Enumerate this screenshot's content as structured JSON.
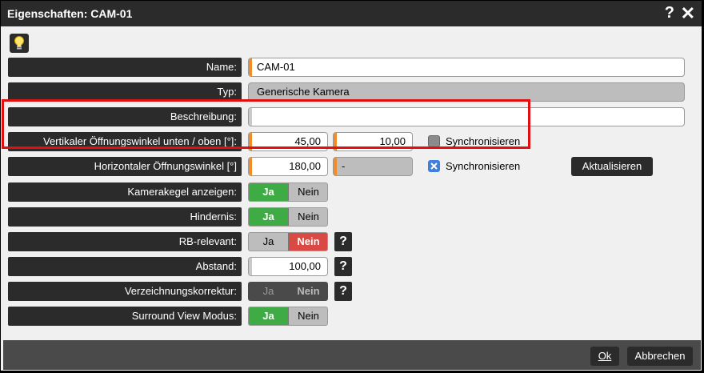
{
  "window": {
    "title": "Eigenschaften: CAM-01",
    "help_glyph": "?",
    "close_glyph": "✕"
  },
  "icons": {
    "hint": "lightbulb-icon",
    "help": "help-icon",
    "close": "close-icon",
    "check": "check-icon"
  },
  "colors": {
    "dark": "#2b2b2b",
    "accent_orange": "#f28c28",
    "toggle_green": "#3fab45",
    "toggle_red": "#d94a44",
    "highlight_red": "#e01010",
    "checkbox_blue": "#3f7fe0"
  },
  "fields": {
    "name": {
      "label": "Name:",
      "value": "CAM-01"
    },
    "typ": {
      "label": "Typ:",
      "value": "Generische Kamera"
    },
    "beschreibung": {
      "label": "Beschreibung:",
      "value": ""
    },
    "vertikal": {
      "label": "Vertikaler Öffnungswinkel unten / oben [°]:",
      "value1": "45,00",
      "value2": "10,00",
      "sync_label": "Synchronisieren",
      "sync_checked": false
    },
    "horizontal": {
      "label": "Horizontaler Öffnungswinkel [°]",
      "value1": "180,00",
      "value2": "-",
      "sync_label": "Synchronisieren",
      "sync_checked": true
    }
  },
  "aktualisieren_label": "Aktualisieren",
  "toggles": {
    "kamerakegel": {
      "label": "Kamerakegel anzeigen:",
      "ja": "Ja",
      "nein": "Nein",
      "selected": "Ja"
    },
    "hindernis": {
      "label": "Hindernis:",
      "ja": "Ja",
      "nein": "Nein",
      "selected": "Ja"
    },
    "rb_relevant": {
      "label": "RB-relevant:",
      "ja": "Ja",
      "nein": "Nein",
      "selected": "Nein"
    },
    "verzeichnung": {
      "label": "Verzeichnungskorrektur:",
      "ja": "Ja",
      "nein": "Nein",
      "selected": "none"
    },
    "surround": {
      "label": "Surround View Modus:",
      "ja": "Ja",
      "nein": "Nein",
      "selected": "Ja"
    }
  },
  "abstand": {
    "label": "Abstand:",
    "value": "100,00"
  },
  "help_label": "?",
  "footer": {
    "ok_label": "Ok",
    "cancel_label": "Abbrechen"
  }
}
